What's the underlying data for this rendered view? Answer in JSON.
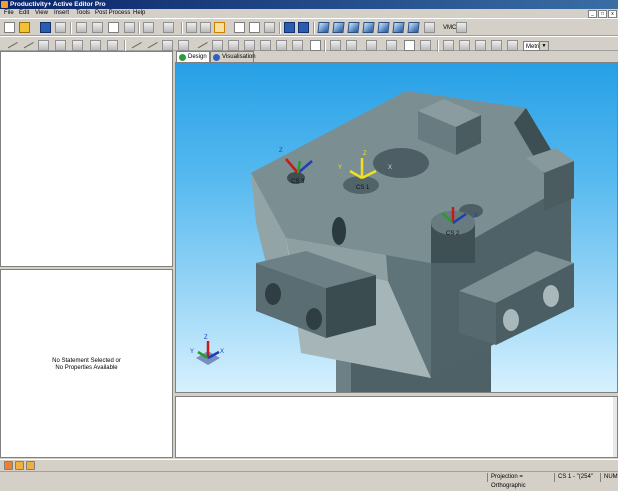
{
  "window": {
    "title": "Productivity+ Active Editor Pro"
  },
  "menu": [
    "File",
    "Edit",
    "View",
    "Insert",
    "Tools",
    "Post Process",
    "Help"
  ],
  "window_controls": [
    "_",
    "□",
    "x"
  ],
  "toolbar": {
    "machine_label": "VMC",
    "units_value": "Metric"
  },
  "tabs": [
    {
      "label": "Design",
      "active": true
    },
    {
      "label": "Visualisation",
      "active": false
    }
  ],
  "properties_panel": {
    "message_line1": "No Statement Selected or",
    "message_line2": "No Properties Available"
  },
  "viewport": {
    "coordinate_systems": [
      {
        "label": "CS 3",
        "axis_x": "X",
        "axis_y": "Y",
        "axis_z": "Z"
      },
      {
        "label": "CS 1",
        "axis_x": "X",
        "axis_y": "Y",
        "axis_z": "Z"
      },
      {
        "label": "CS 2",
        "axis_x": "X",
        "axis_y": "Y",
        "axis_z": "Z"
      }
    ],
    "triad": {
      "x": "X",
      "y": "Y",
      "z": "Z"
    }
  },
  "status": {
    "projection": "Projection = Orthographic",
    "coordinate_system": "CS 1 - \"(254\"",
    "num": "NUM"
  },
  "colors": {
    "viewport_top": "#27a0e6",
    "viewport_bottom": "#d6f1ff",
    "part_face": "#5f7479",
    "part_top": "#7b8e92",
    "part_side_light": "#a6b6b8",
    "axis_x": "#1f3fb0",
    "axis_y": "#2b9a2b",
    "axis_z": "#c81818",
    "axis_yellow": "#f0e020"
  }
}
